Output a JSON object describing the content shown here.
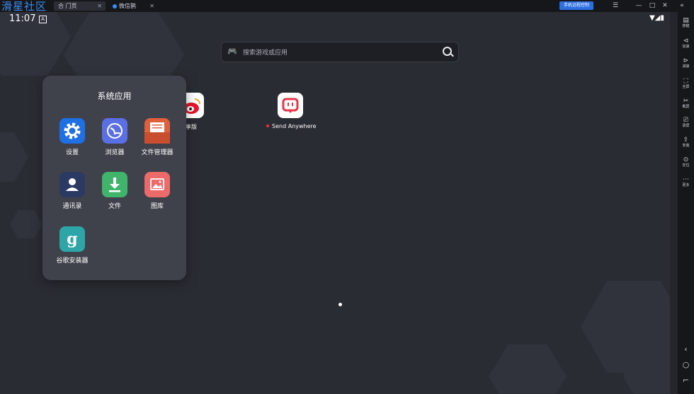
{
  "watermark": "滑星社区",
  "tabs": [
    {
      "label": "合 门页",
      "active": true
    },
    {
      "label": "微信鹊",
      "active": false
    }
  ],
  "titlebar": {
    "promo": "手机远程控制",
    "controls": [
      "☰",
      "—",
      "□",
      "✕",
      "«"
    ]
  },
  "status": {
    "time": "11:07",
    "a_badge": "A",
    "right": "▼◢▮"
  },
  "search": {
    "placeholder": "搜索游戏或应用"
  },
  "desktop_apps": [
    {
      "label": "微博轻享版"
    },
    {
      "label": "Send Anywhere"
    }
  ],
  "folder": {
    "title": "系统应用",
    "apps": [
      {
        "label": "设置",
        "color": "#1f6fe5"
      },
      {
        "label": "浏览器",
        "color": "#5b6fe4"
      },
      {
        "label": "文件管理器",
        "color": "#e0603e"
      },
      {
        "label": "通讯录",
        "color": "#2b3a63"
      },
      {
        "label": "文件",
        "color": "#3fb46a"
      },
      {
        "label": "图库",
        "color": "#ec6a6a"
      },
      {
        "label": "谷歌安装器",
        "color": "#2ea6a8"
      }
    ]
  },
  "sidebar": {
    "items": [
      {
        "glyph": "▤",
        "label": "按键"
      },
      {
        "glyph": "⊲",
        "label": "加速"
      },
      {
        "glyph": "⊳",
        "label": "减速"
      },
      {
        "glyph": "⛶",
        "label": "全屏"
      },
      {
        "glyph": "✂",
        "label": "截屏"
      },
      {
        "glyph": "⎚",
        "label": "录屏"
      },
      {
        "glyph": "⇪",
        "label": "安装"
      },
      {
        "glyph": "⊙",
        "label": "定位"
      },
      {
        "glyph": "⋯",
        "label": "更多"
      }
    ],
    "nav": [
      "‹",
      "○",
      "⌐"
    ]
  }
}
